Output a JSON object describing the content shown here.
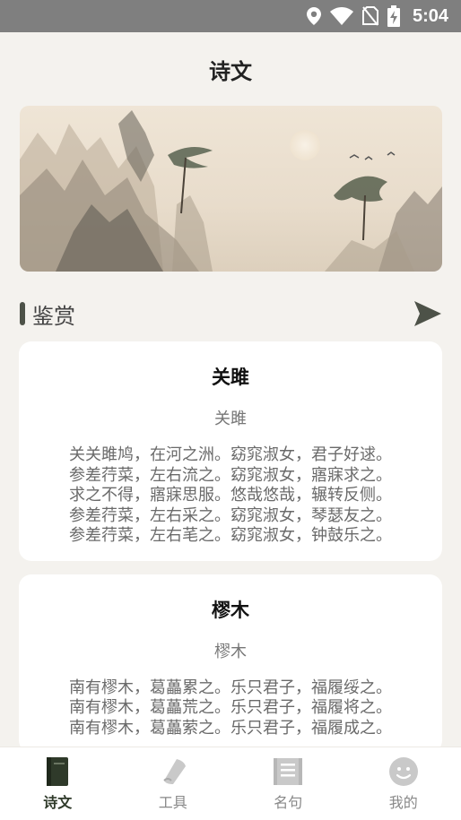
{
  "status_bar": {
    "time": "5:04",
    "icons": [
      "location-icon",
      "wifi-icon",
      "no-sim-icon",
      "battery-charging-icon"
    ]
  },
  "app_bar": {
    "title": "诗文"
  },
  "banner": {
    "image": "ink-landscape-painting"
  },
  "section": {
    "title": "鉴赏",
    "more_icon": "play-arrow-icon"
  },
  "poems": [
    {
      "title": "关雎",
      "subtitle": "关雎",
      "lines": "关关雎鸠，在河之洲。窈窕淑女，君子好逑。\n参差荇菜，左右流之。窈窕淑女，寤寐求之。\n求之不得，寤寐思服。悠哉悠哉，辗转反侧。\n参差荇菜，左右采之。窈窕淑女，琴瑟友之。\n参差荇菜，左右芼之。窈窕淑女，钟鼓乐之。"
    },
    {
      "title": "樛木",
      "subtitle": "樛木",
      "lines": "南有樛木，葛藟累之。乐只君子，福履绥之。\n南有樛木，葛藟荒之。乐只君子，福履将之。\n南有樛木，葛藟萦之。乐只君子，福履成之。"
    }
  ],
  "bottom_nav": {
    "items": [
      {
        "label": "诗文",
        "icon": "book-icon",
        "active": true
      },
      {
        "label": "工具",
        "icon": "scroll-icon",
        "active": false
      },
      {
        "label": "名句",
        "icon": "document-icon",
        "active": false
      },
      {
        "label": "我的",
        "icon": "smiley-icon",
        "active": false
      }
    ]
  },
  "colors": {
    "accent": "#2f3a2a",
    "background": "#f4f2ee",
    "status_bar": "#7f7f7f"
  }
}
